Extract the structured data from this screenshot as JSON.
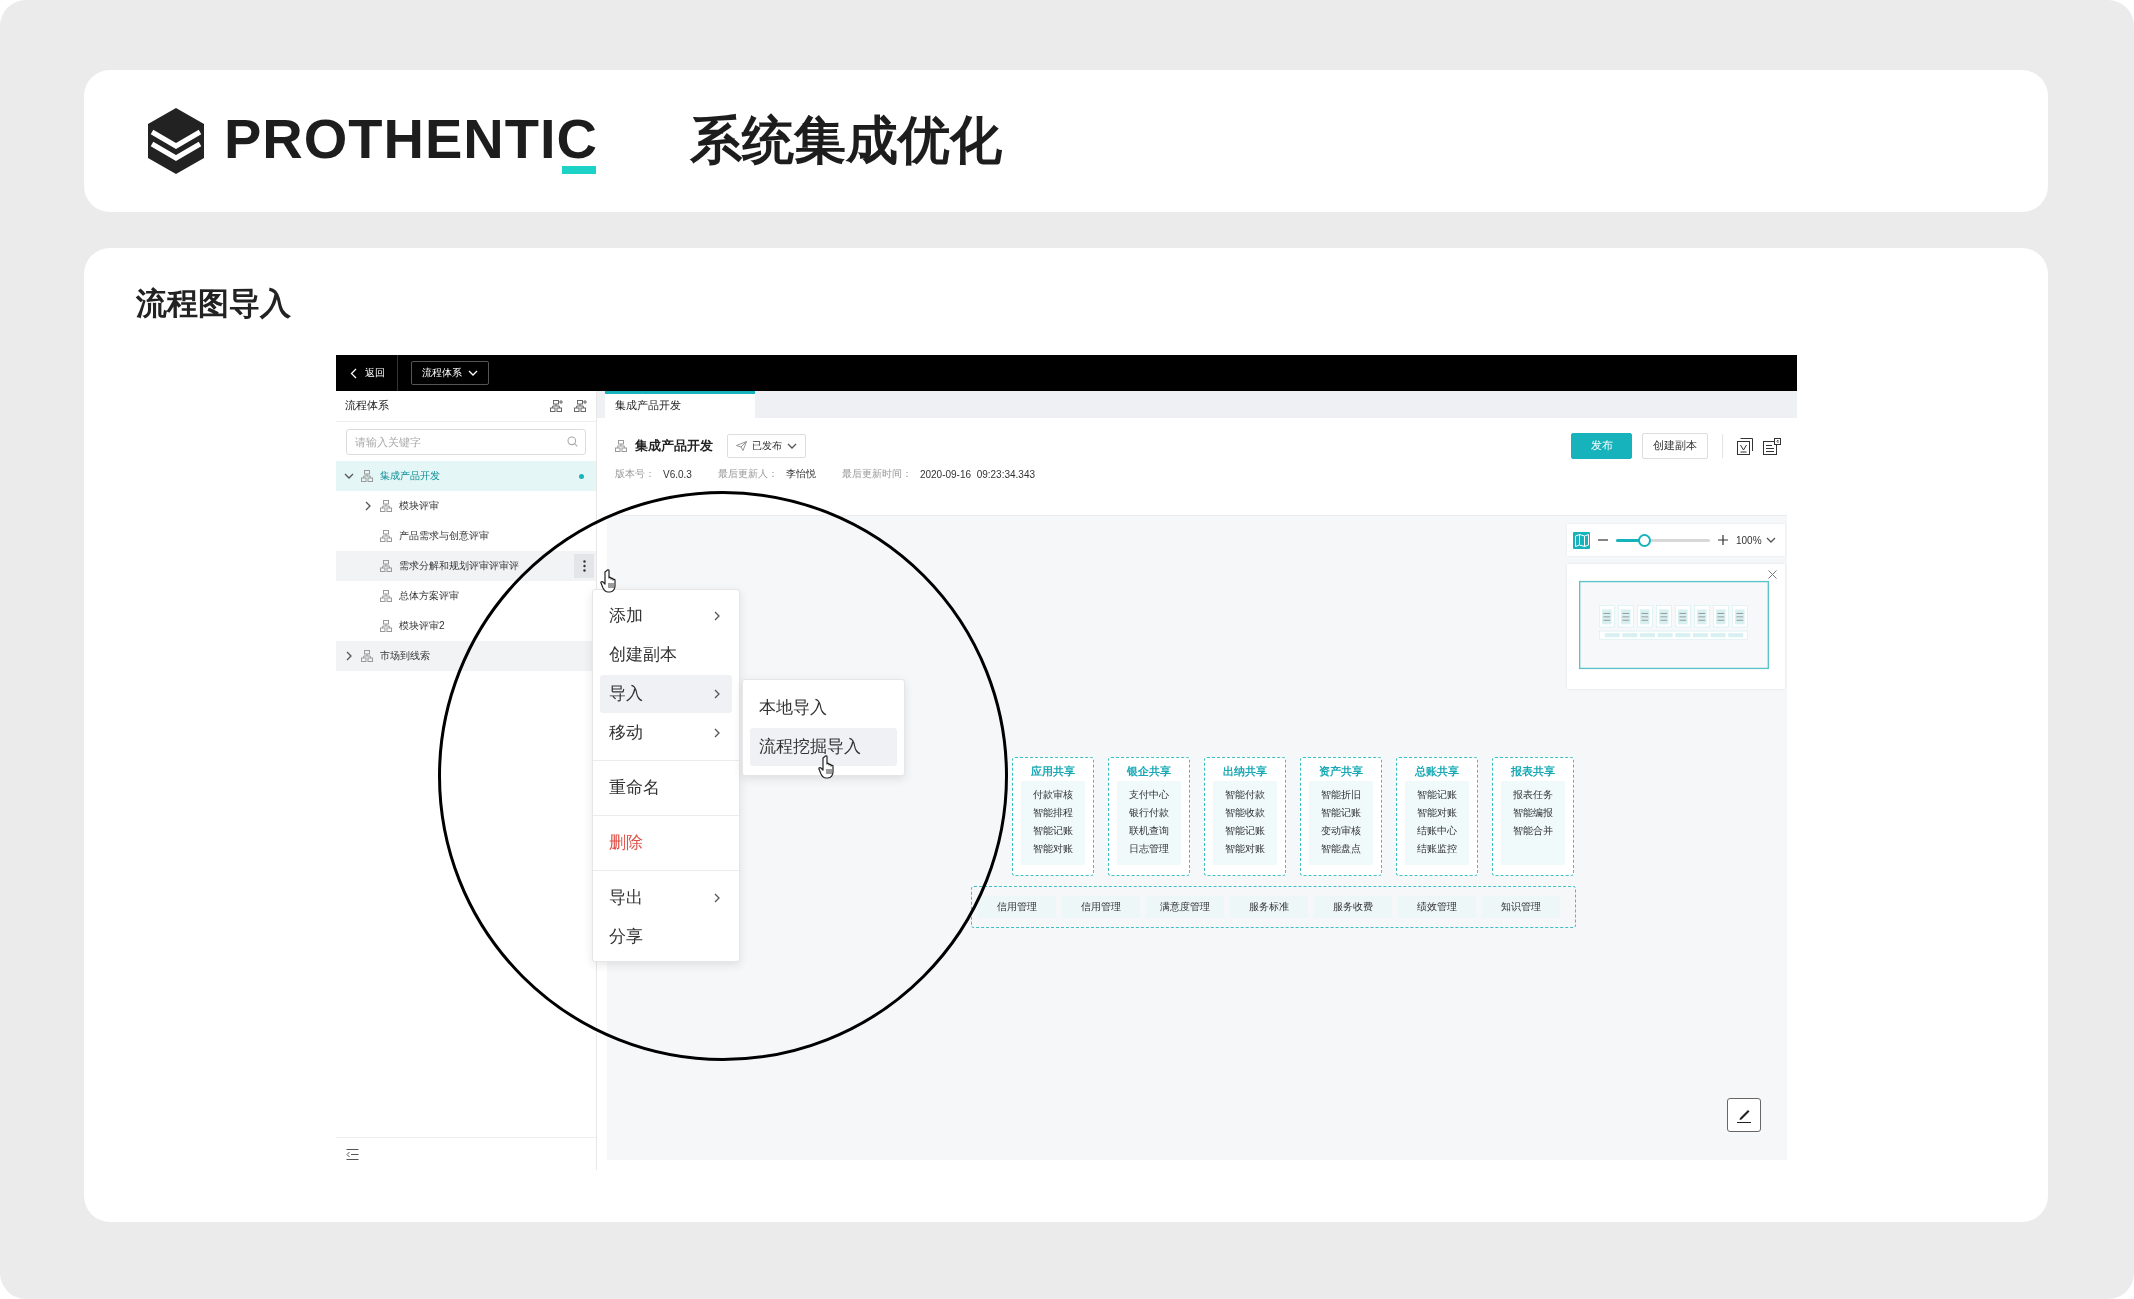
{
  "header": {
    "logo_text": "PROTHENTIC",
    "title": "系统集成优化"
  },
  "section": {
    "title": "流程图导入"
  },
  "app": {
    "top_bar": {
      "back": "返回",
      "dropdown": "流程体系"
    },
    "sidebar": {
      "title": "流程体系",
      "search": {
        "placeholder": "请输入关键字"
      },
      "tree": [
        {
          "label": "集成产品开发",
          "expanded": true,
          "selected": true,
          "hovered": false,
          "dot": true,
          "menu_open": false,
          "children": [
            {
              "label": "模块评审",
              "expanded": false,
              "selected": false,
              "hovered": false,
              "dot": false,
              "menu_open": false
            },
            {
              "label": "产品需求与创意评审",
              "selected": false,
              "hovered": false,
              "dot": false,
              "menu_open": false
            },
            {
              "label": "需求分解和规划评审评审评",
              "selected": false,
              "hovered": true,
              "dot": false,
              "menu_open": true
            },
            {
              "label": "总体方案评审",
              "selected": false,
              "hovered": false,
              "dot": false,
              "menu_open": false
            },
            {
              "label": "模块评审2",
              "selected": false,
              "hovered": false,
              "dot": false,
              "menu_open": false
            }
          ]
        },
        {
          "label": "市场到线索",
          "expanded": false,
          "selected": false,
          "hovered": true,
          "dot": false,
          "menu_open": false
        }
      ]
    },
    "tabs": [
      {
        "label": "集成产品开发",
        "selected": true
      }
    ],
    "document": {
      "title": "集成产品开发",
      "status": "已发布",
      "meta": [
        {
          "label": "版本号：",
          "value": "V6.0.3"
        },
        {
          "label": "最后更新人：",
          "value": "李怡悦"
        },
        {
          "label": "最后更新时间：",
          "value": "2020-09-16  09:23:34.343"
        }
      ],
      "buttons": [
        {
          "label": "发布",
          "primary": true
        },
        {
          "label": "创建副本",
          "primary": false
        }
      ]
    },
    "zoom": {
      "level": 0.3,
      "value": "100%"
    },
    "diagram": {
      "groups": [
        {
          "title": "应用共享",
          "items": [
            "付款审核",
            "智能排程",
            "智能记账",
            "智能对账"
          ]
        },
        {
          "title": "银企共享",
          "items": [
            "支付中心",
            "银行付款",
            "联机查询",
            "日志管理"
          ]
        },
        {
          "title": "出纳共享",
          "items": [
            "智能付款",
            "智能收款",
            "智能记账",
            "智能对账"
          ]
        },
        {
          "title": "资产共享",
          "items": [
            "智能折旧",
            "智能记账",
            "变动审核",
            "智能盘点"
          ]
        },
        {
          "title": "总账共享",
          "items": [
            "智能记账",
            "智能对账",
            "结账中心",
            "结账监控"
          ]
        },
        {
          "title": "报表共享",
          "items": [
            "报表任务",
            "智能编报",
            "智能合并"
          ]
        }
      ],
      "bottom": [
        "信用管理",
        "信用管理",
        "满意度管理",
        "服务标准",
        "服务收费",
        "绩效管理",
        "知识管理"
      ]
    },
    "context_menu": {
      "items": [
        {
          "kind": "item",
          "label": "添加",
          "submenu": true,
          "selected": false,
          "danger": false
        },
        {
          "kind": "item",
          "label": "创建副本",
          "submenu": false,
          "selected": false,
          "danger": false
        },
        {
          "kind": "item",
          "label": "导入",
          "submenu": true,
          "selected": true,
          "danger": false
        },
        {
          "kind": "item",
          "label": "移动",
          "submenu": true,
          "selected": false,
          "danger": false
        },
        {
          "kind": "divider"
        },
        {
          "kind": "item",
          "label": "重命名",
          "submenu": false,
          "selected": false,
          "danger": false
        },
        {
          "kind": "divider"
        },
        {
          "kind": "item",
          "label": "删除",
          "submenu": false,
          "selected": false,
          "danger": true
        },
        {
          "kind": "divider"
        },
        {
          "kind": "item",
          "label": "导出",
          "submenu": true,
          "selected": false,
          "danger": false
        },
        {
          "kind": "item",
          "label": "分享",
          "submenu": false,
          "selected": false,
          "danger": false
        }
      ]
    },
    "submenu": {
      "items": [
        {
          "label": "本地导入",
          "selected": false
        },
        {
          "label": "流程挖掘导入",
          "selected": true
        }
      ]
    }
  }
}
